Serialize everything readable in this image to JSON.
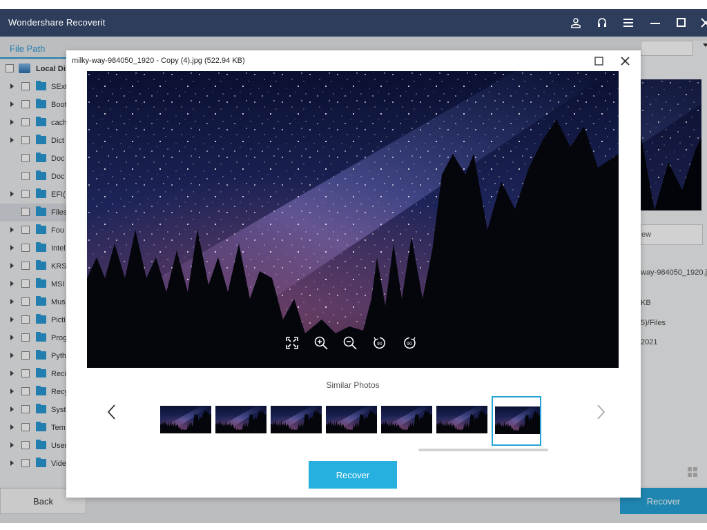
{
  "app": {
    "title": "Wondershare Recoverit",
    "tab": "File Path",
    "back_label": "Back",
    "recover_label": "Recover"
  },
  "tree": {
    "drive_label": "Local Dis",
    "items": [
      {
        "label": "SExt",
        "expandable": true
      },
      {
        "label": "Boot",
        "expandable": true
      },
      {
        "label": "cach",
        "expandable": true
      },
      {
        "label": "Dict",
        "expandable": true
      },
      {
        "label": "Doc",
        "expandable": false
      },
      {
        "label": "Doc",
        "expandable": false
      },
      {
        "label": "EFI(",
        "expandable": true
      },
      {
        "label": "Files",
        "expandable": false
      },
      {
        "label": "Fou",
        "expandable": true
      },
      {
        "label": "Intel",
        "expandable": true
      },
      {
        "label": "KRSI",
        "expandable": true
      },
      {
        "label": "MSI",
        "expandable": true
      },
      {
        "label": "Mus",
        "expandable": true
      },
      {
        "label": "Picti",
        "expandable": true
      },
      {
        "label": "Prog",
        "expandable": true
      },
      {
        "label": "Pyth",
        "expandable": true
      },
      {
        "label": "Reci",
        "expandable": true
      },
      {
        "label": "Recy",
        "expandable": true
      },
      {
        "label": "Syst",
        "expandable": true
      },
      {
        "label": "Tem",
        "expandable": true
      },
      {
        "label": "User",
        "expandable": true
      },
      {
        "label": "Vide",
        "expandable": true
      }
    ]
  },
  "right_panel": {
    "preview_button": "ew",
    "file_name": "way-984050_1920.jp",
    "size": "KB",
    "path": "5)/Files",
    "date": "2021"
  },
  "modal": {
    "title": "milky-way-984050_1920 - Copy (4).jpg (522.94 KB)",
    "similar_label": "Similar Photos",
    "recover_label": "Recover",
    "thumbnail_count": 7,
    "selected_thumbnail": 7
  },
  "icons": {
    "titlebar": [
      "user-icon",
      "headset-icon",
      "menu-icon",
      "minimize-icon",
      "maximize-icon",
      "close-icon"
    ],
    "preview_tools": [
      "fit-screen-icon",
      "zoom-in-icon",
      "zoom-out-icon",
      "rotate-left-icon",
      "rotate-right-icon"
    ]
  },
  "colors": {
    "titlebar": "#2e3d5b",
    "accent": "#26a4d8",
    "recover_button": "#26b0e0"
  }
}
